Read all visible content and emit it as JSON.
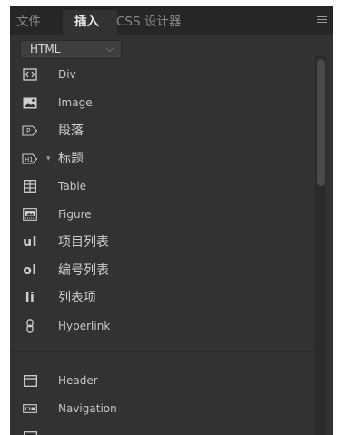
{
  "tabs": [
    {
      "label": "文件",
      "active": false
    },
    {
      "label": "插入",
      "active": true
    },
    {
      "label": "CSS 设计器",
      "active": false
    }
  ],
  "menu_icon": "hamburger-menu-icon",
  "category_select": {
    "value": "HTML",
    "arrow_icon": "chevron-down-icon"
  },
  "items": [
    {
      "label": "Div",
      "icon": "div-tag-icon"
    },
    {
      "label": "Image",
      "icon": "image-icon"
    },
    {
      "label": "段落",
      "icon": "paragraph-icon"
    },
    {
      "label": "标题",
      "icon": "heading-icon",
      "icon_text": "H1",
      "has_dropdown": true
    },
    {
      "label": "Table",
      "icon": "table-icon"
    },
    {
      "label": "Figure",
      "icon": "figure-icon"
    },
    {
      "label": "项目列表",
      "icon": "unordered-list-icon",
      "icon_text": "ul"
    },
    {
      "label": "编号列表",
      "icon": "ordered-list-icon",
      "icon_text": "ol"
    },
    {
      "label": "列表项",
      "icon": "list-item-icon",
      "icon_text": "li"
    },
    {
      "label": "Hyperlink",
      "icon": "hyperlink-icon"
    },
    {
      "label": "Header",
      "icon": "header-icon"
    },
    {
      "label": "Navigation",
      "icon": "navigation-icon"
    },
    {
      "label": "",
      "icon": "main-icon"
    }
  ],
  "colors": {
    "panel_bg": "#323232",
    "tabbar_bg": "#262626",
    "text": "#c6c6c6",
    "icon": "#cfcfcf"
  }
}
